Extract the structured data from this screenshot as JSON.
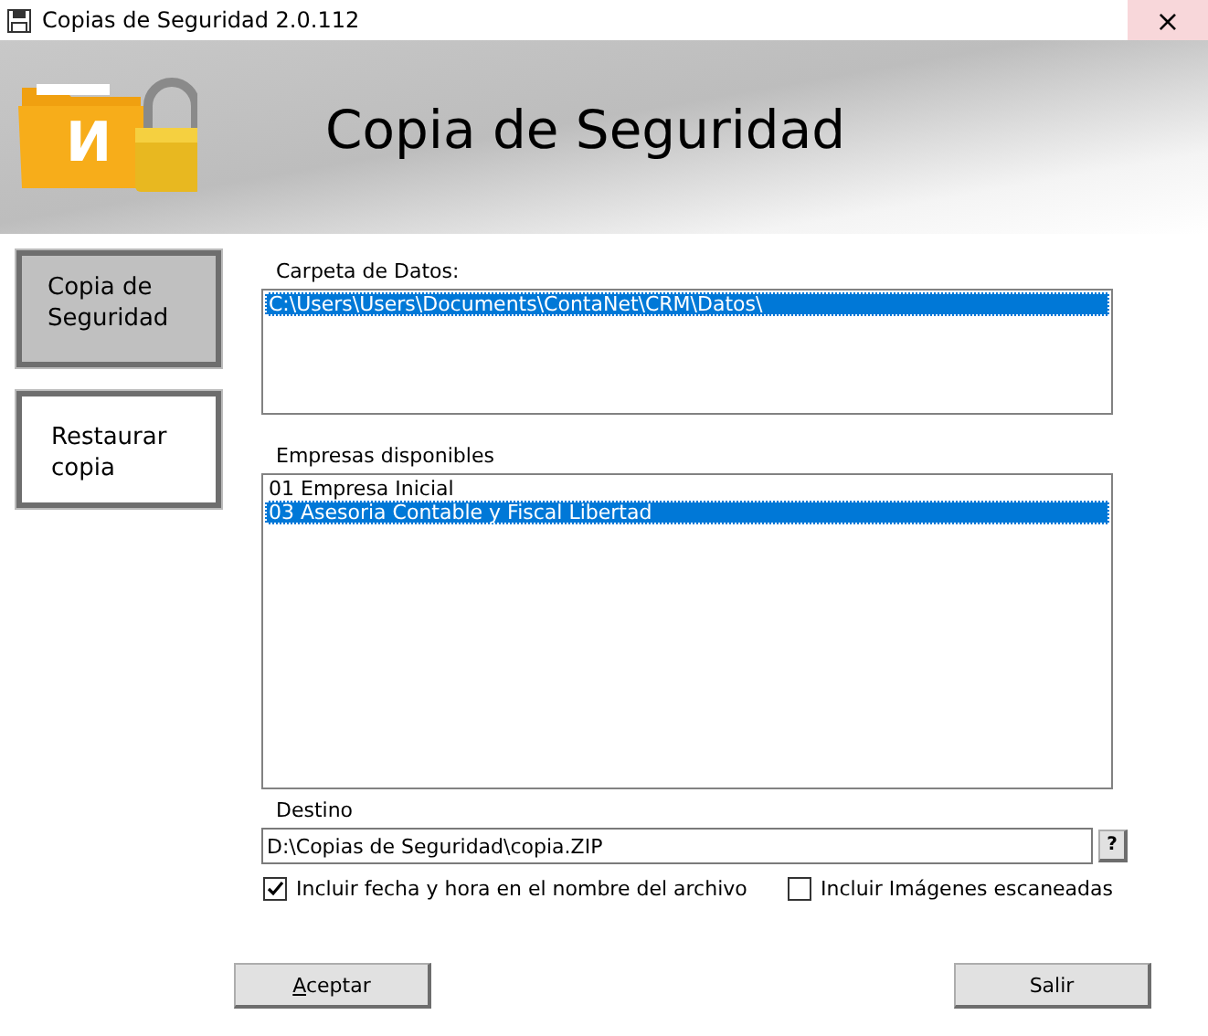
{
  "window": {
    "title": "Copias de Seguridad 2.0.112",
    "close": "×"
  },
  "header": {
    "logo_letter": "И",
    "title": "Copia de Seguridad"
  },
  "sidebar": {
    "items": [
      {
        "label": "Copia de Seguridad",
        "selected": true
      },
      {
        "label": "Restaurar copia",
        "selected": false
      }
    ]
  },
  "data_folder": {
    "label": "Carpeta de Datos:",
    "items": [
      {
        "text": "C:\\Users\\Users\\Documents\\ContaNet\\CRM\\Datos\\",
        "selected": true
      }
    ]
  },
  "companies": {
    "label": "Empresas disponibles",
    "items": [
      {
        "text": "01 Empresa Inicial",
        "selected": false
      },
      {
        "text": "03 Asesoria Contable y Fiscal Libertad",
        "selected": true
      }
    ]
  },
  "destination": {
    "label": "Destino",
    "value": "D:\\Copias de Seguridad\\copia.ZIP",
    "browse": "?"
  },
  "options": [
    {
      "label": "Incluir fecha y hora en el nombre del archivo",
      "checked": true
    },
    {
      "label": "Incluir Imágenes escaneadas",
      "checked": false
    }
  ],
  "buttons": [
    {
      "label": "Aceptar",
      "access_key": true
    },
    {
      "label": "Salir",
      "access_key": false
    }
  ]
}
